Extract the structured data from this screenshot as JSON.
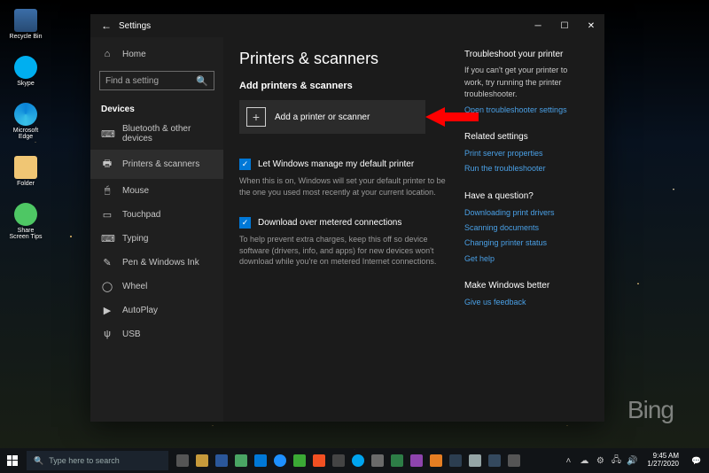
{
  "desktop": {
    "icons": [
      {
        "label": "Recycle Bin"
      },
      {
        "label": "Skype"
      },
      {
        "label": "Microsoft Edge"
      },
      {
        "label": "Folder"
      },
      {
        "label": "Share Screen Tips"
      }
    ],
    "watermark": "Bing"
  },
  "window": {
    "title": "Settings",
    "back_label": "←"
  },
  "sidebar": {
    "home": "Home",
    "search_placeholder": "Find a setting",
    "group": "Devices",
    "items": [
      {
        "icon": "bt",
        "label": "Bluetooth & other devices"
      },
      {
        "icon": "printer",
        "label": "Printers & scanners"
      },
      {
        "icon": "mouse",
        "label": "Mouse"
      },
      {
        "icon": "touchpad",
        "label": "Touchpad"
      },
      {
        "icon": "typing",
        "label": "Typing"
      },
      {
        "icon": "pen",
        "label": "Pen & Windows Ink"
      },
      {
        "icon": "wheel",
        "label": "Wheel"
      },
      {
        "icon": "autoplay",
        "label": "AutoPlay"
      },
      {
        "icon": "usb",
        "label": "USB"
      }
    ]
  },
  "main": {
    "h1": "Printers & scanners",
    "h2": "Add printers & scanners",
    "add_label": "Add a printer or scanner",
    "check1_label": "Let Windows manage my default printer",
    "check1_desc": "When this is on, Windows will set your default printer to be the one you used most recently at your current location.",
    "check2_label": "Download over metered connections",
    "check2_desc": "To help prevent extra charges, keep this off so device software (drivers, info, and apps) for new devices won't download while you're on metered Internet connections."
  },
  "right": {
    "troubleshoot_title": "Troubleshoot your printer",
    "troubleshoot_text": "If you can't get your printer to work, try running the printer troubleshooter.",
    "troubleshoot_link": "Open troubleshooter settings",
    "related_title": "Related settings",
    "related_link1": "Print server properties",
    "related_link2": "Run the troubleshooter",
    "question_title": "Have a question?",
    "q_link1": "Downloading print drivers",
    "q_link2": "Scanning documents",
    "q_link3": "Changing printer status",
    "q_link4": "Get help",
    "better_title": "Make Windows better",
    "better_link": "Give us feedback"
  },
  "taskbar": {
    "search_placeholder": "Type here to search",
    "time": "9:45 AM",
    "date": "1/27/2020"
  }
}
